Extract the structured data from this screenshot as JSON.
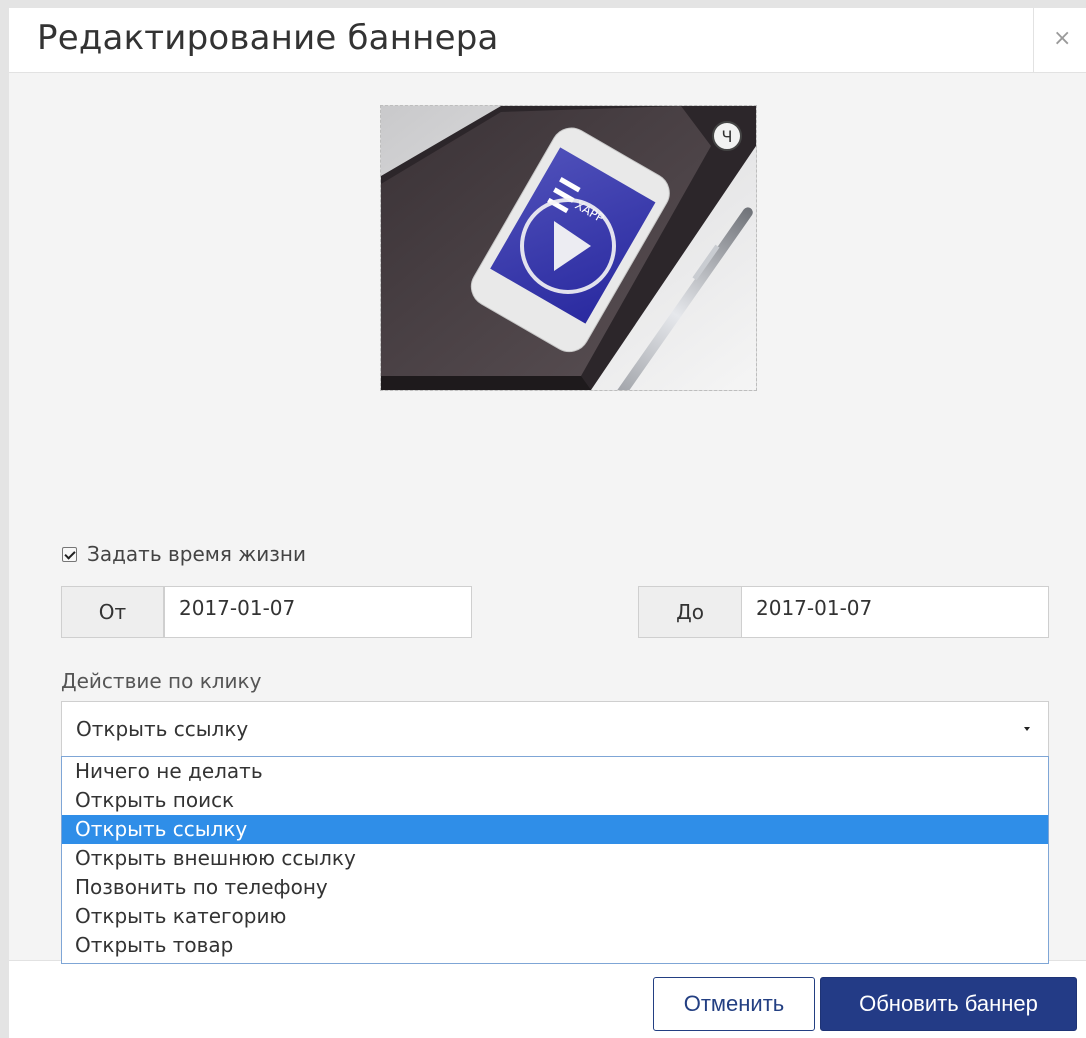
{
  "modal": {
    "title": "Редактирование баннера",
    "close_symbol": "×"
  },
  "banner": {
    "phone_brand_text": "XAPP",
    "corner_badge": "Ч",
    "icons": [
      "play-icon",
      "corner-badge-icon"
    ]
  },
  "lifetime": {
    "checkbox_checked": true,
    "label": "Задать время жизни",
    "from_label": "От",
    "from_value": "2017-01-07",
    "to_label": "До",
    "to_value": "2017-01-07"
  },
  "click_action": {
    "label": "Действие по клику",
    "selected": "Открыть ссылку",
    "options": [
      "Ничего не делать",
      "Открыть поиск",
      "Открыть ссылку",
      "Открыть внешнюю ссылку",
      "Позвонить по телефону",
      "Открыть категорию",
      "Открыть товар"
    ],
    "highlighted_index": 2
  },
  "footer": {
    "cancel_label": "Отменить",
    "submit_label": "Обновить баннер"
  },
  "colors": {
    "primary": "#233b86",
    "highlight": "#2f8ee8",
    "body_bg": "#f4f4f4"
  }
}
